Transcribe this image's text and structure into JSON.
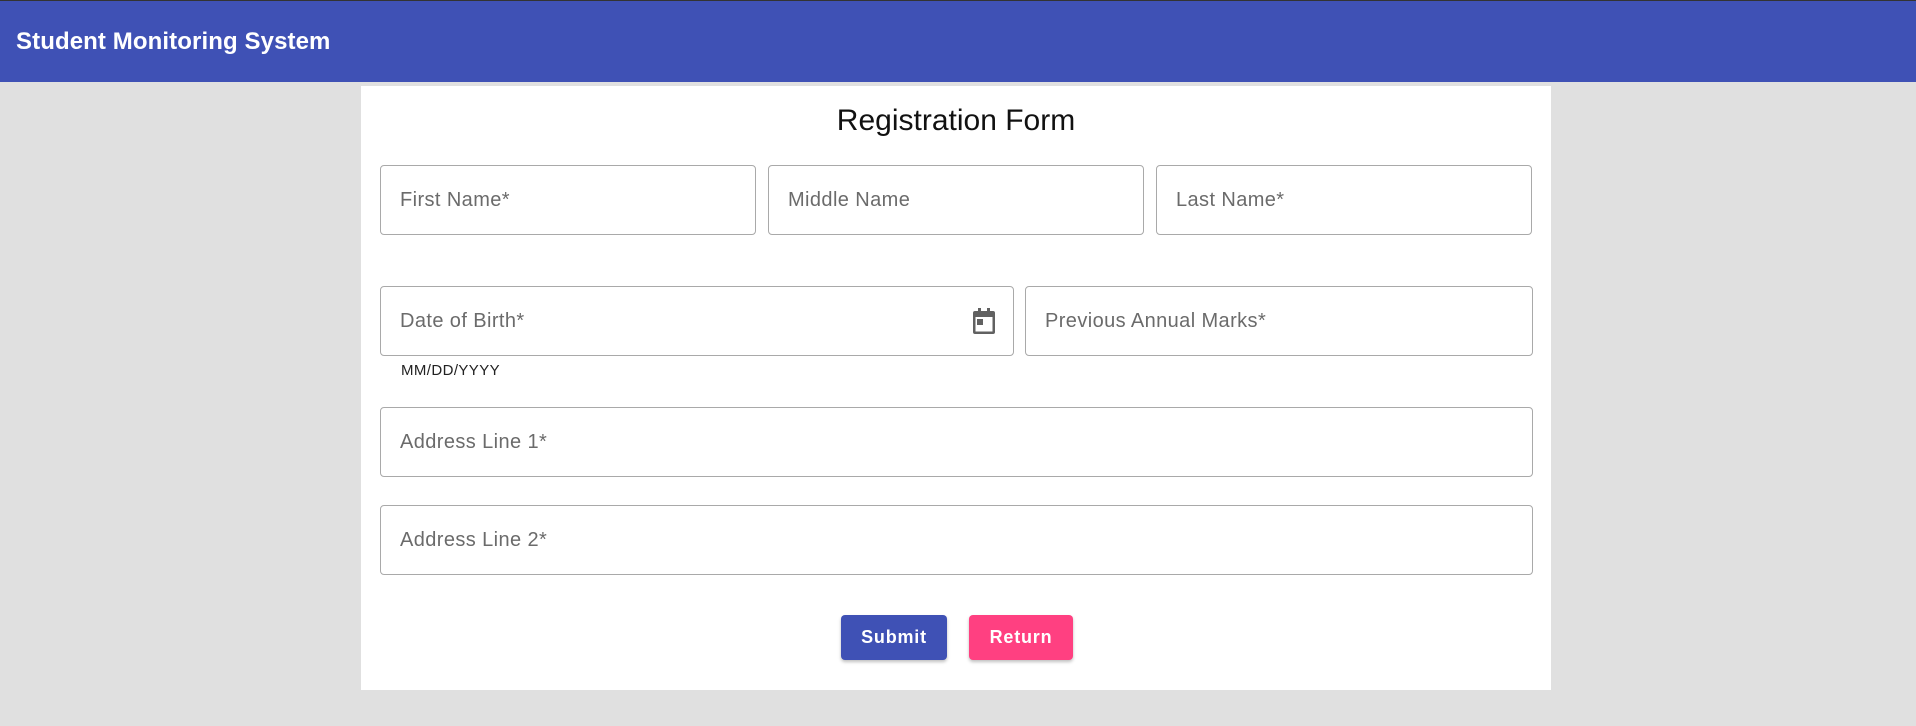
{
  "app": {
    "title": "Student Monitoring System"
  },
  "form": {
    "title": "Registration Form",
    "fields": {
      "first_name": {
        "label": "First Name*",
        "value": ""
      },
      "middle_name": {
        "label": "Middle Name",
        "value": ""
      },
      "last_name": {
        "label": "Last Name*",
        "value": ""
      },
      "date_of_birth": {
        "label": "Date of Birth*",
        "hint": "MM/DD/YYYY",
        "icon": "calendar-icon",
        "value": ""
      },
      "previous_marks": {
        "label": "Previous Annual Marks*",
        "value": ""
      },
      "address_line_1": {
        "label": "Address Line 1*",
        "value": ""
      },
      "address_line_2": {
        "label": "Address Line 2*",
        "value": ""
      }
    },
    "buttons": {
      "submit": "Submit",
      "return": "Return"
    }
  },
  "colors": {
    "primary": "#3f51b5",
    "accent": "#ff4081",
    "background": "#e0e0e0",
    "card": "#ffffff"
  }
}
